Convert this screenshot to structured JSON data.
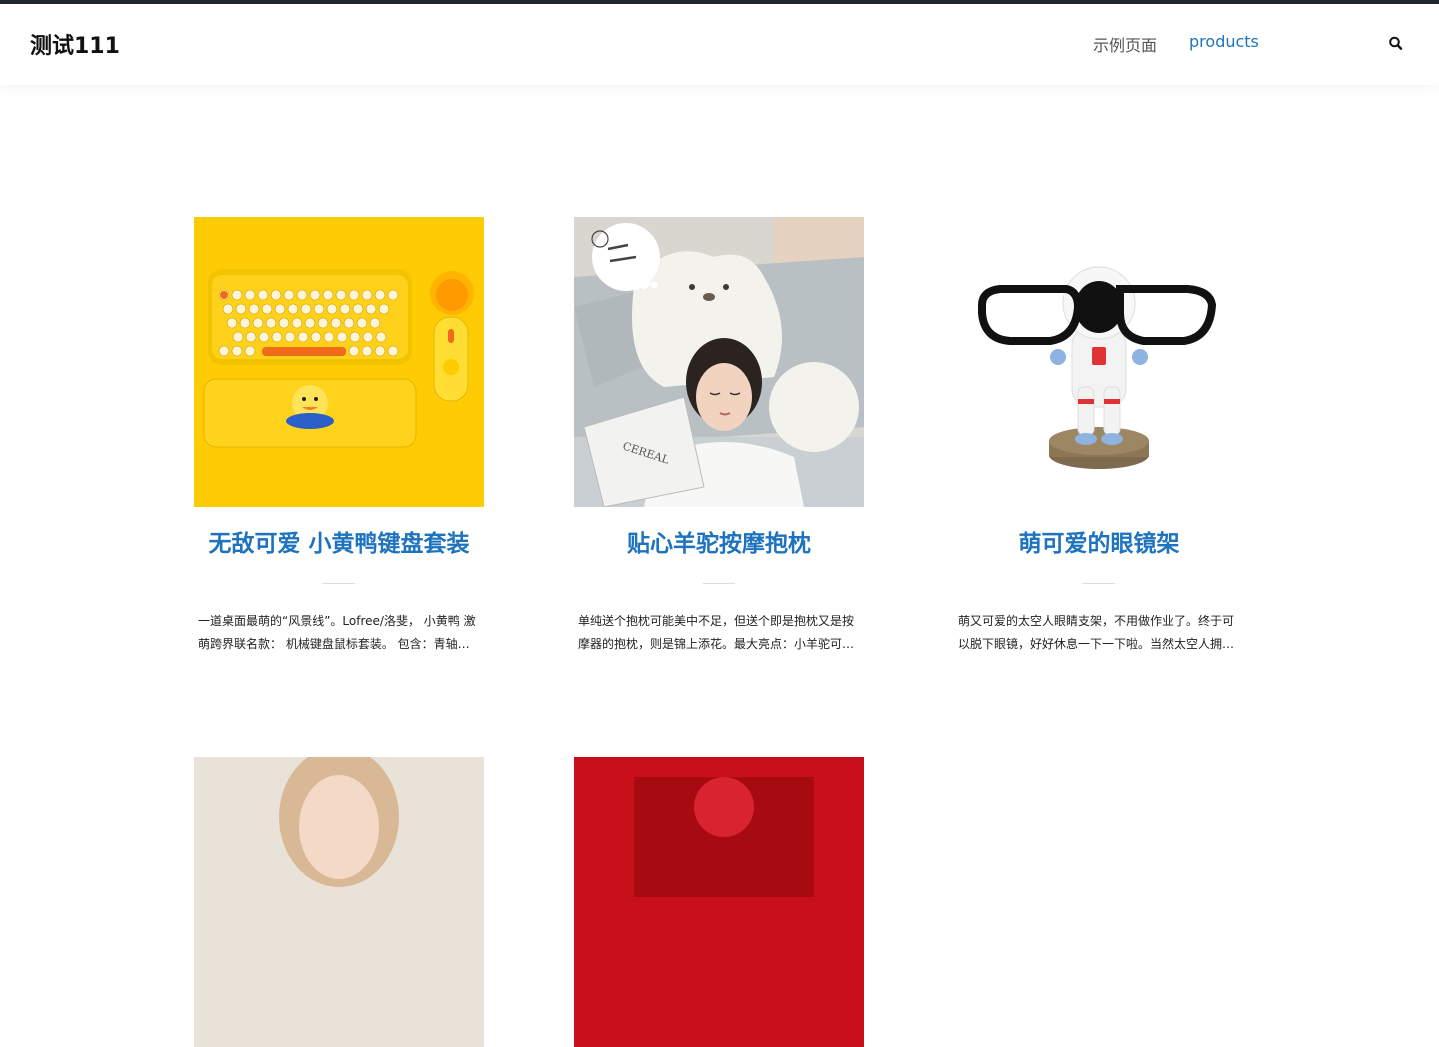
{
  "site": {
    "title": "测试111"
  },
  "nav": {
    "items": [
      {
        "label": "示例页面"
      },
      {
        "label": "products"
      }
    ]
  },
  "colors": {
    "accent": "#1e73be",
    "topline": "#23282d"
  },
  "icons": {
    "search": "search-icon"
  },
  "products": [
    {
      "title": "无敌可爱 小黄鸭键盘套装",
      "excerpt": "一道桌面最萌的“风景线”。Lofree/洛斐， 小黄鸭 激萌跨界联名款： 机械键盘鼠标套装。 包含：青轴无线键盘、鼠标、腕托"
    },
    {
      "title": "贴心羊驼按摩抱枕",
      "excerpt": "单纯送个抱枕可能美中不足，但送个即是抱枕又是按摩器的抱枕，则是锦上添花。最大亮点：小羊驼可爱的造型"
    },
    {
      "title": "萌可爱的眼镜架",
      "excerpt": "萌又可爱的太空人眼睛支架，不用做作业了。终于可以脱下眼镜，好好休息一下一下啦。当然太空人拥有超能力"
    }
  ]
}
